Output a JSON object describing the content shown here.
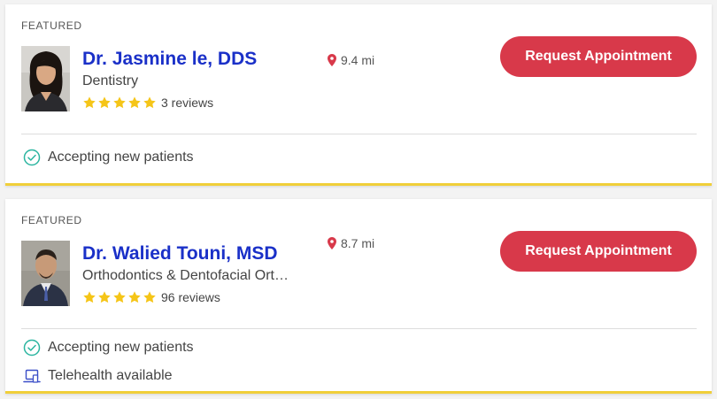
{
  "listings": [
    {
      "tag": "FEATURED",
      "name": "Dr. Jasmine le, DDS",
      "specialty": "Dentistry",
      "rating": 5,
      "reviews": "3 reviews",
      "distance": "9.4 mi",
      "button": "Request Appointment",
      "features": [
        "Accepting new patients"
      ]
    },
    {
      "tag": "FEATURED",
      "name": "Dr. Walied Touni, MSD",
      "specialty": "Orthodontics & Dentofacial Ort…",
      "rating": 5,
      "reviews": "96 reviews",
      "distance": "8.7 mi",
      "button": "Request Appointment",
      "features": [
        "Accepting new patients",
        "Telehealth available"
      ]
    }
  ],
  "colors": {
    "accent": "#d8394a",
    "name": "#1a30c8",
    "star": "#f5c518",
    "featured_border": "#f0cf3a",
    "check": "#2bb5a0",
    "telehealth_icon": "#3a4ec8"
  },
  "icons": {
    "location": "map-pin-icon",
    "accepting": "check-circle-icon",
    "telehealth": "laptop-icon",
    "rating": "star-icon"
  }
}
